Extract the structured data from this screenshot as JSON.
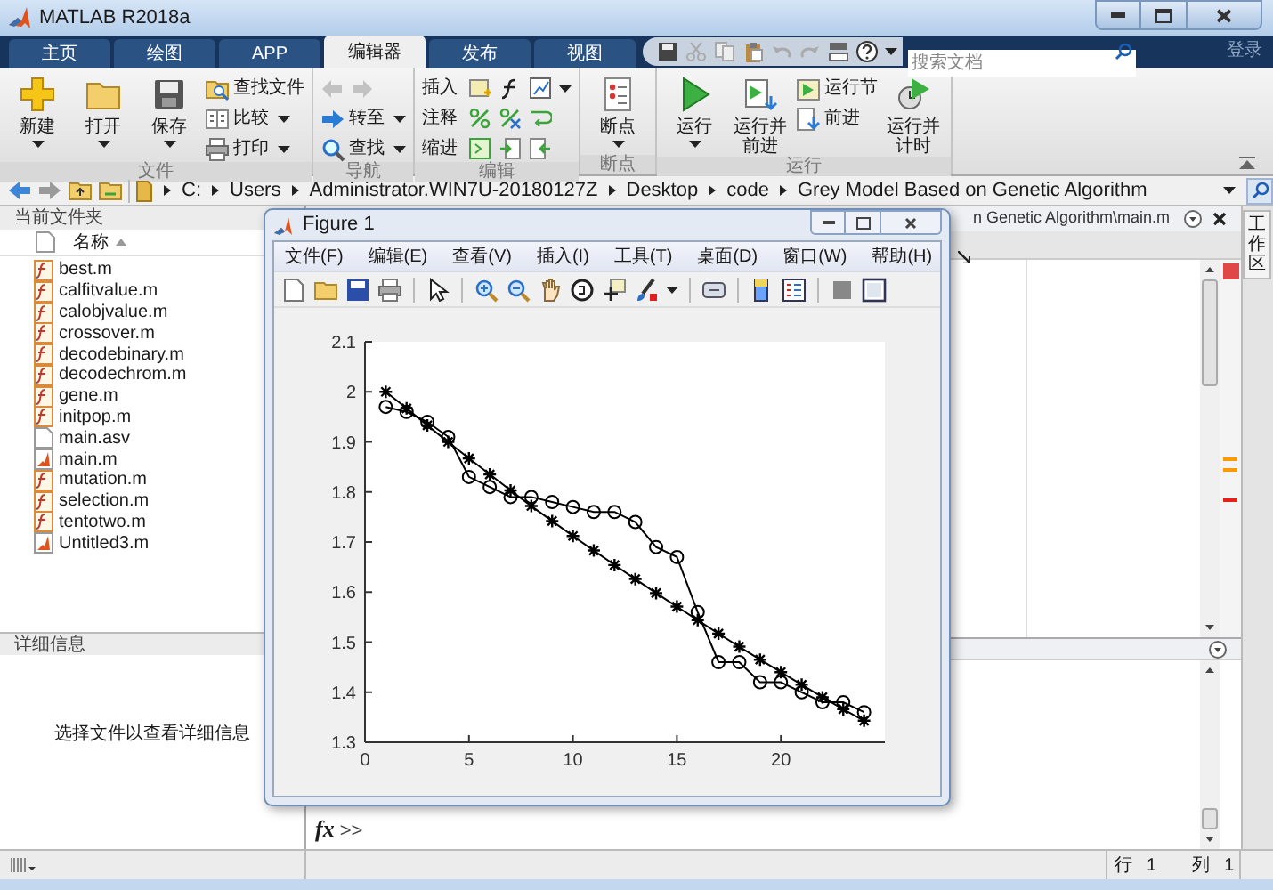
{
  "window": {
    "title": "MATLAB R2018a"
  },
  "tabs": [
    {
      "label": "主页",
      "selected": false
    },
    {
      "label": "绘图",
      "selected": false
    },
    {
      "label": "APP",
      "selected": false
    },
    {
      "label": "编辑器",
      "selected": true
    },
    {
      "label": "发布",
      "selected": false
    },
    {
      "label": "视图",
      "selected": false
    }
  ],
  "search": {
    "placeholder": "搜索文档"
  },
  "sign_in": "登录",
  "ribbon": {
    "groups": [
      {
        "label": "文件",
        "buttons": [
          {
            "kind": "large",
            "label": "新建",
            "dropdown": true
          },
          {
            "kind": "large",
            "label": "打开",
            "dropdown": true
          },
          {
            "kind": "large",
            "label": "保存",
            "dropdown": true
          },
          {
            "kind": "small",
            "label": "查找文件",
            "dropdown": false
          },
          {
            "kind": "small",
            "label": "比较",
            "dropdown": true
          },
          {
            "kind": "small",
            "label": "打印",
            "dropdown": true
          }
        ]
      },
      {
        "label": "导航",
        "buttons": [
          {
            "kind": "arrows",
            "disabled": true
          },
          {
            "kind": "small",
            "label": "转至",
            "dropdown": true
          },
          {
            "kind": "small",
            "label": "查找",
            "dropdown": true
          }
        ]
      },
      {
        "label": "编辑",
        "buttons": [
          {
            "kind": "row",
            "label": "插入",
            "dropdown": true
          },
          {
            "kind": "row",
            "label": "注释",
            "dropdown": false
          },
          {
            "kind": "row",
            "label": "缩进",
            "dropdown": false
          }
        ]
      },
      {
        "label": "断点",
        "buttons": [
          {
            "kind": "large",
            "label": "断点",
            "dropdown": true
          }
        ]
      },
      {
        "label": "运行",
        "buttons": [
          {
            "kind": "large",
            "label": "运行",
            "dropdown": true
          },
          {
            "kind": "large",
            "label": "运行并前进",
            "dropdown": false
          },
          {
            "kind": "small",
            "label": "运行节",
            "dropdown": false
          },
          {
            "kind": "small",
            "label": "前进",
            "dropdown": false
          },
          {
            "kind": "large",
            "label": "运行并计时",
            "dropdown": false
          }
        ]
      }
    ]
  },
  "address_bar": {
    "segments": [
      "C:",
      "Users",
      "Administrator.WIN7U-20180127Z",
      "Desktop",
      "code",
      "Grey Model Based on Genetic Algorithm"
    ]
  },
  "current_folder": {
    "title": "当前文件夹",
    "column": "名称",
    "files": [
      {
        "name": "best.m",
        "kind": "function"
      },
      {
        "name": "calfitvalue.m",
        "kind": "function"
      },
      {
        "name": "calobjvalue.m",
        "kind": "function"
      },
      {
        "name": "crossover.m",
        "kind": "function"
      },
      {
        "name": "decodebinary.m",
        "kind": "function"
      },
      {
        "name": "decodechrom.m",
        "kind": "function"
      },
      {
        "name": "gene.m",
        "kind": "function"
      },
      {
        "name": "initpop.m",
        "kind": "function"
      },
      {
        "name": "main.asv",
        "kind": "file"
      },
      {
        "name": "main.m",
        "kind": "script"
      },
      {
        "name": "mutation.m",
        "kind": "function"
      },
      {
        "name": "selection.m",
        "kind": "function"
      },
      {
        "name": "tentotwo.m",
        "kind": "function"
      },
      {
        "name": "Untitled3.m",
        "kind": "script"
      }
    ]
  },
  "details": {
    "title": "详细信息",
    "message": "选择文件以查看详细信息"
  },
  "editor": {
    "tab_title": "n Genetic Algorithm\\main.m",
    "markers": [
      {
        "color": "#ff9900"
      },
      {
        "color": "#ff9900"
      },
      {
        "color": "#e8201a"
      }
    ]
  },
  "command_window": {
    "function_button": "fx",
    "prompt": ">>"
  },
  "workspace_tab": "工作区",
  "status_bar": {
    "line_label": "行",
    "line": "1",
    "column_label": "列",
    "column": "1"
  },
  "figure": {
    "title": "Figure 1",
    "menu": [
      "文件(F)",
      "编辑(E)",
      "查看(V)",
      "插入(I)",
      "工具(T)",
      "桌面(D)",
      "窗口(W)",
      "帮助(H)"
    ],
    "chart_data": {
      "type": "line",
      "x": [
        1,
        2,
        3,
        4,
        5,
        6,
        7,
        8,
        9,
        10,
        11,
        12,
        13,
        14,
        15,
        16,
        17,
        18,
        19,
        20,
        21,
        22,
        23,
        24
      ],
      "series": [
        {
          "marker": "cross",
          "color": "#000000",
          "values": [
            2.0,
            1.967,
            1.933,
            1.9,
            1.867,
            1.835,
            1.803,
            1.772,
            1.742,
            1.712,
            1.683,
            1.654,
            1.626,
            1.598,
            1.571,
            1.544,
            1.517,
            1.491,
            1.465,
            1.44,
            1.415,
            1.39,
            1.366,
            1.343
          ]
        },
        {
          "marker": "circle",
          "color": "#000000",
          "values": [
            1.97,
            1.96,
            1.94,
            1.91,
            1.83,
            1.81,
            1.79,
            1.79,
            1.78,
            1.77,
            1.76,
            1.76,
            1.74,
            1.69,
            1.67,
            1.56,
            1.46,
            1.46,
            1.42,
            1.42,
            1.4,
            1.38,
            1.38,
            1.36
          ]
        }
      ],
      "xlim": [
        0,
        25
      ],
      "ylim": [
        1.3,
        2.1
      ],
      "xticks": [
        0,
        5,
        10,
        15,
        20
      ],
      "yticks": [
        1.3,
        1.4,
        1.5,
        1.6,
        1.7,
        1.8,
        1.9,
        2,
        2.1
      ]
    }
  }
}
